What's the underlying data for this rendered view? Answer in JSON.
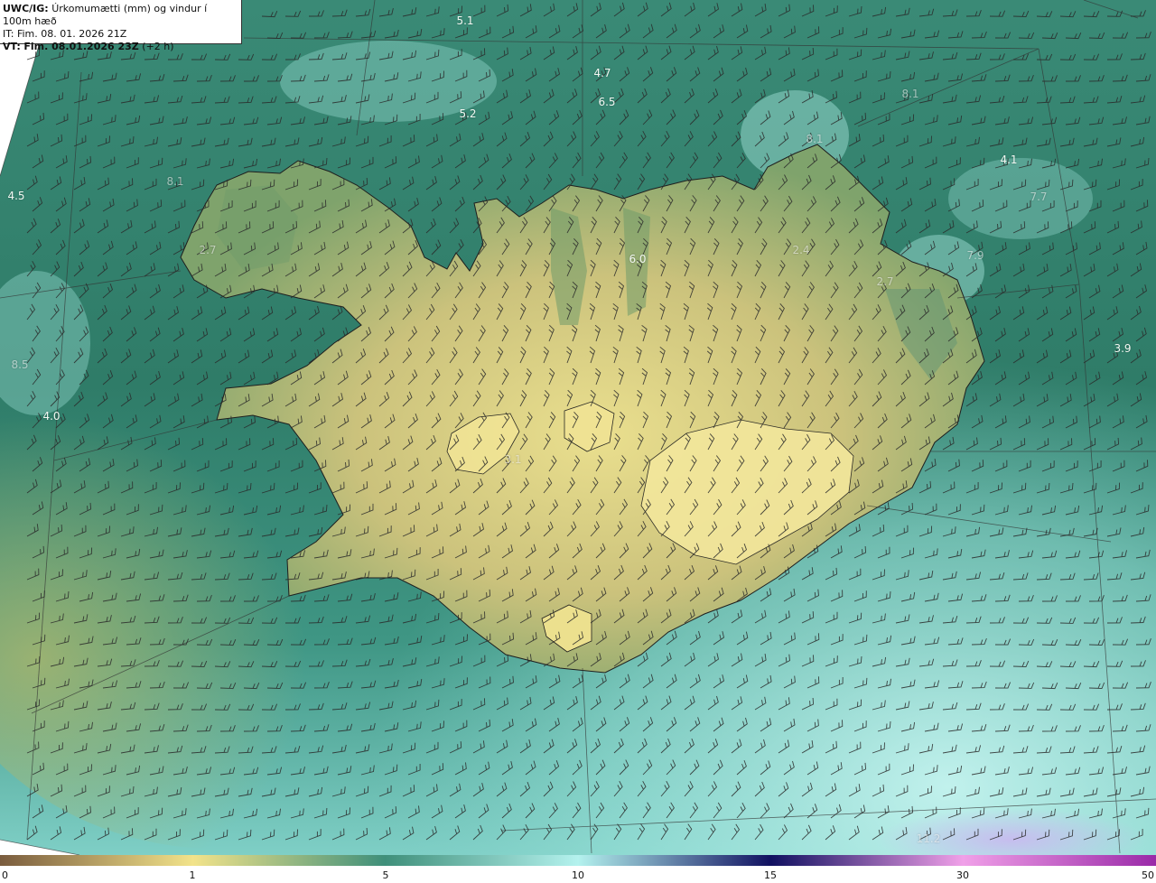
{
  "header": {
    "product_code": "UWC/IG:",
    "product_title": "Úrkomumætti (mm) og vindur í 100m hæð",
    "it_line": "IT: Fim. 08. 01. 2026 21Z",
    "vt_prefix": "VT:",
    "vt_time": "Fim. 08.01.2026 23Z",
    "vt_offset": "(+2 h)"
  },
  "map_labels": [
    {
      "text": "5.1"
    },
    {
      "text": "4.7"
    },
    {
      "text": "6.5"
    },
    {
      "text": "5.2"
    },
    {
      "text": "8.1"
    },
    {
      "text": "8.1"
    },
    {
      "text": "4.5"
    },
    {
      "text": "8.1"
    },
    {
      "text": "4.1"
    },
    {
      "text": "7.7"
    },
    {
      "text": "2.7"
    },
    {
      "text": "6.0"
    },
    {
      "text": "2.4"
    },
    {
      "text": "7.9"
    },
    {
      "text": "2.7"
    },
    {
      "text": "3.9"
    },
    {
      "text": "8.5"
    },
    {
      "text": "4.0"
    },
    {
      "text": "3.1"
    },
    {
      "text": "11.2"
    }
  ],
  "colorbar": {
    "ticks": [
      "0",
      "1",
      "5",
      "10",
      "15",
      "30",
      "50"
    ],
    "colors": {
      "zero": "#7a5c3e",
      "one": "#f2e38a",
      "five": "#3f8f7a",
      "ten": "#b4f2ee",
      "fifteen": "#101060",
      "thirty": "#f0a0e8",
      "fifty": "#9a2aa8"
    }
  },
  "field_colors": {
    "sea_dark": "#2e7564",
    "sea_mid": "#3c8c78",
    "sea_light": "#8fd3c8",
    "land_low": "#8aa86a",
    "land_high": "#e6d98a",
    "barb": "#333333",
    "coast": "#1e1e1e"
  }
}
